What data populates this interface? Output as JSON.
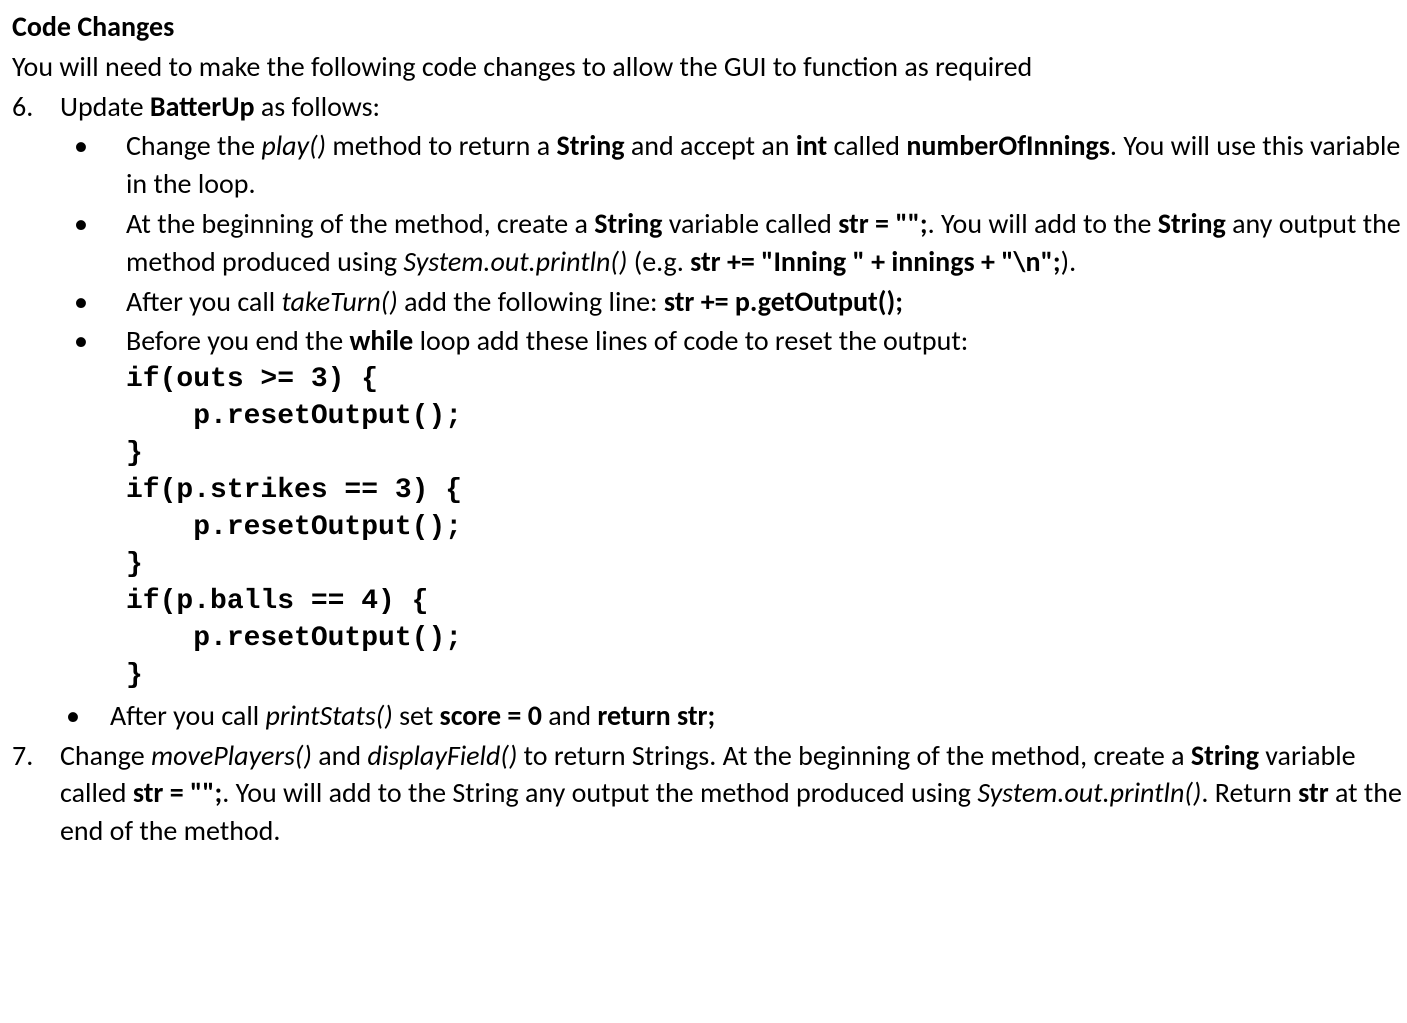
{
  "heading": "Code Changes",
  "intro": "You will need to make the following code changes to allow the GUI to function as required",
  "item6": {
    "marker": "6.",
    "lead_a": "Update ",
    "lead_b": "BatterUp",
    "lead_c": " as follows:",
    "b1": {
      "a": "Change the ",
      "b": "play()",
      "c": " method to return a ",
      "d": "String",
      "e": " and accept an ",
      "f": "int",
      "g": " called ",
      "h": "numberOfInnings",
      "i": ". You will use this variable in the loop."
    },
    "b2": {
      "a": "At the beginning of the method, create a ",
      "b": "String",
      "c": " variable called ",
      "d": "str = \"\";",
      "e": ". You will add to the ",
      "f": "String",
      "g": " any output the method produced using ",
      "h": "System.out.println()",
      "i": " (e.g. ",
      "j": "str += \"Inning \" + innings + \"\\n\";",
      "k": ")."
    },
    "b3": {
      "a": "After you call ",
      "b": "takeTurn()",
      "c": " add the following line: ",
      "d": "str += p.getOutput();"
    },
    "b4": {
      "a": "Before you end the ",
      "b": "while",
      "c": " loop add these lines of code to reset the output:"
    },
    "code": "if(outs >= 3) {\n    p.resetOutput();\n}\nif(p.strikes == 3) {\n    p.resetOutput();\n}\nif(p.balls == 4) {\n    p.resetOutput();\n}",
    "b5": {
      "a": "After you call ",
      "b": "printStats()",
      "c": " set ",
      "d": "score = 0",
      "e": " and ",
      "f": "return str;"
    }
  },
  "item7": {
    "marker": "7.",
    "a": "Change ",
    "b": "movePlayers()",
    "c": " and ",
    "d": "displayField()",
    "e": " to return Strings. At the beginning of the method, create a ",
    "f": "String",
    "g": " variable called ",
    "h": "str = \"\";",
    "i": ". You will add to the String any output the method produced using ",
    "j": "System.out.println()",
    "k": ". Return ",
    "l": "str",
    "m": " at the end of the method."
  },
  "bullet": "•"
}
